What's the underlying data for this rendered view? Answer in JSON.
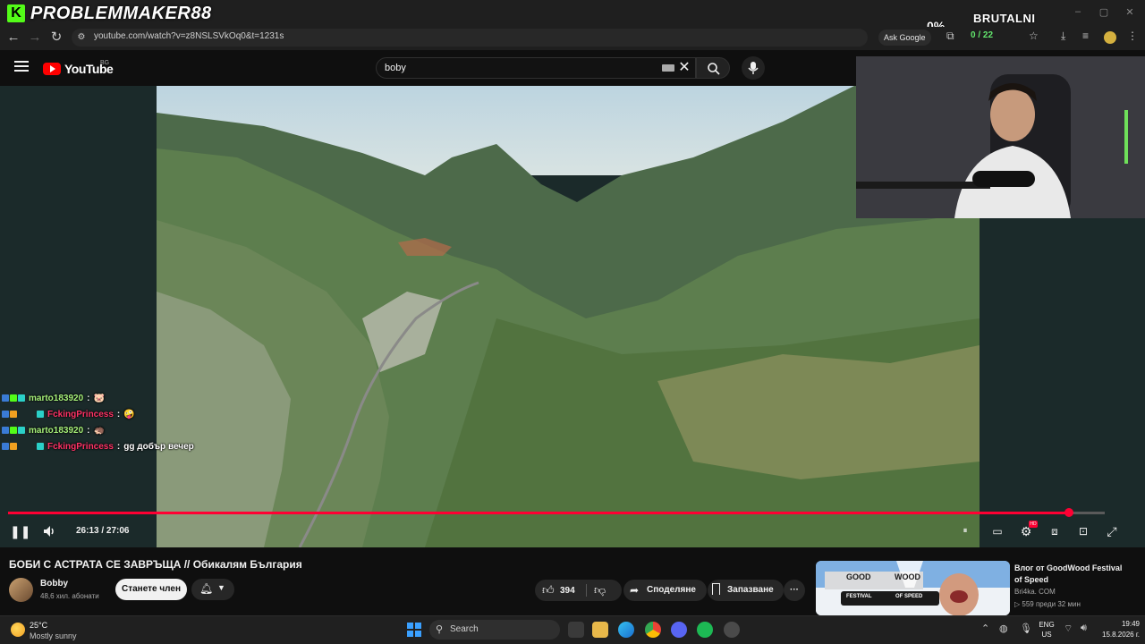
{
  "stream_overlay": {
    "logo_letter": "K",
    "streamer_name": "PROBLEMMAKER88",
    "percent": "0%",
    "tag": "BRUTALNI"
  },
  "browser": {
    "url": "youtube.com/watch?v=z8NSLSVkOq0&t=1231s",
    "ask_google": "Ask Google",
    "extension_counter": "0 / 22"
  },
  "youtube": {
    "wordmark": "YouTube",
    "region": "BG",
    "search_value": "boby"
  },
  "chat": [
    {
      "user": "marto183920",
      "msg": "",
      "emote": "🐷",
      "color": "#a6f07a"
    },
    {
      "user": "FckingPrincess",
      "msg": "",
      "emote": "🤪",
      "color": "#ff3366"
    },
    {
      "user": "marto183920",
      "msg": "",
      "emote": "🦔",
      "color": "#a6f07a"
    },
    {
      "user": "FckingPrincess",
      "msg": "gg добър вечер",
      "emote": "",
      "color": "#ff3366"
    }
  ],
  "player": {
    "time_display": "26:13 / 27:06",
    "progress": 0.967,
    "settings_badge": "HD"
  },
  "video": {
    "title": "БОБИ С АСТРАТА СЕ ЗАВРЪЩА // Обикалям България",
    "channel": "Bobby",
    "subscribers": "48,6 хил. абонати",
    "join_label": "Станете член",
    "likes": "394",
    "share_label": "Споделяне",
    "save_label": "Запазване"
  },
  "recommended": {
    "title": "Влог от GoodWood Festival of Speed",
    "channel": "Bri4ka. COM",
    "meta": "▷ 559 преди 32 мин",
    "thumb_top": "GOOD",
    "thumb_mid": "FESTIVAL",
    "thumb_right": "WOOD",
    "thumb_sub": "OF SPEED"
  },
  "taskbar": {
    "temperature": "25°C",
    "weather": "Mostly sunny",
    "search_label": "Search",
    "lang_top": "ENG",
    "lang_bottom": "US",
    "time": "19:49",
    "date": "15.8.2026 г."
  }
}
